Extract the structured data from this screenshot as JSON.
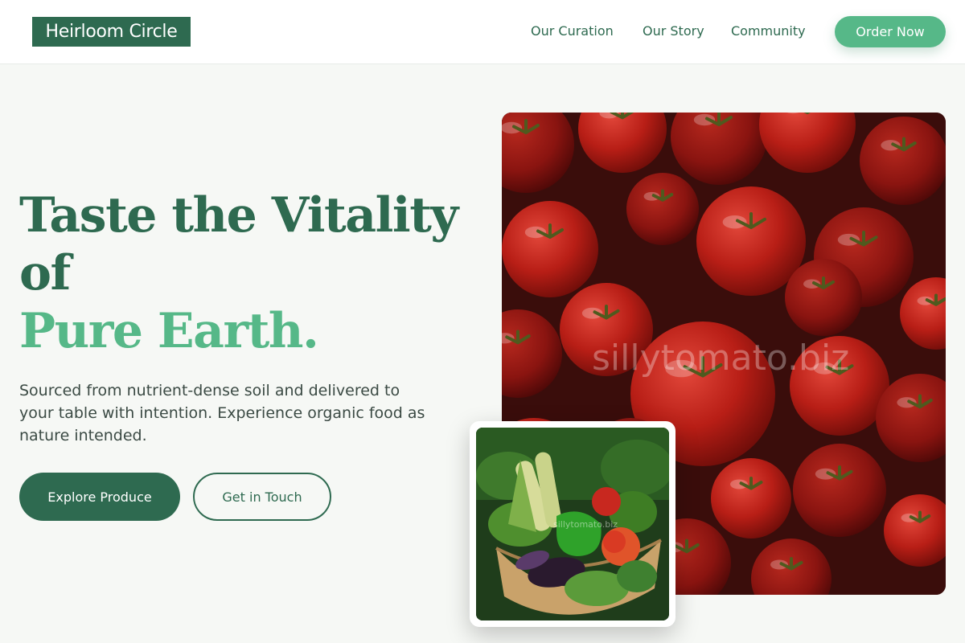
{
  "brand": {
    "name": "Heirloom Circle"
  },
  "nav": {
    "items": [
      {
        "label": "Our Curation"
      },
      {
        "label": "Our Story"
      },
      {
        "label": "Community"
      }
    ],
    "cta_label": "Order Now"
  },
  "hero": {
    "headline_line1": "Taste the Vitality of",
    "headline_accent": "Pure Earth.",
    "subtitle": "Sourced from nutrient-dense soil and delivered to your table with intention. Experience organic food as nature intended.",
    "primary_button": "Explore Produce",
    "secondary_button": "Get in Touch"
  },
  "images": {
    "main_watermark": "sillytomato.biz",
    "card_watermark": "sillytomato.biz"
  },
  "colors": {
    "brand_dark": "#2e6a50",
    "brand_accent": "#56b888",
    "background": "#f6f8f5",
    "tomato_red": "#c0241a"
  }
}
